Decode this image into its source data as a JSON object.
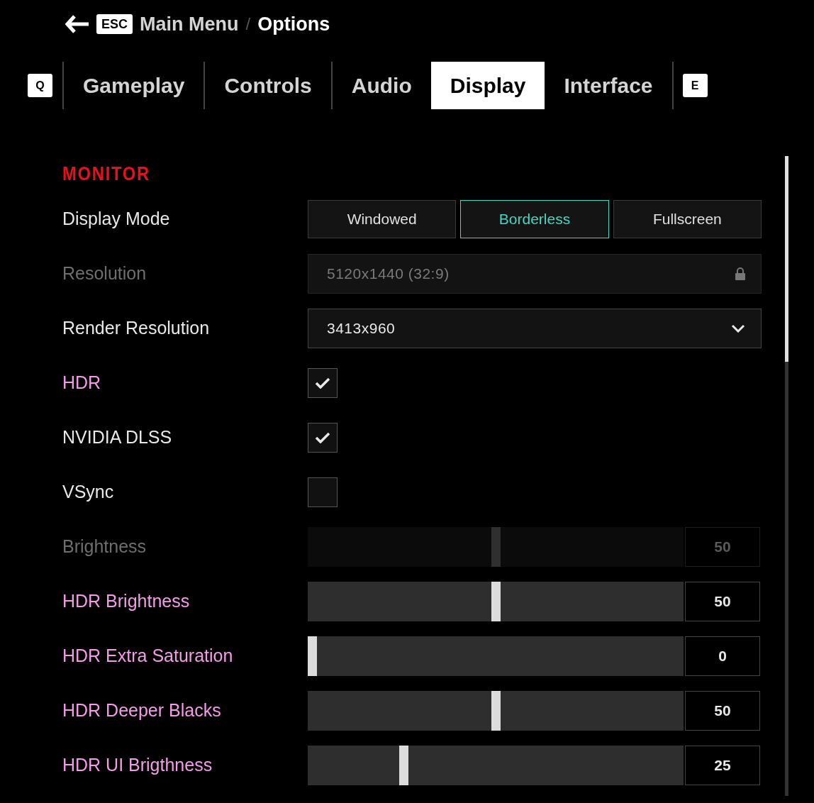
{
  "header": {
    "back_key": "ESC",
    "breadcrumb_parent": "Main Menu",
    "separator": "/",
    "breadcrumb_current": "Options"
  },
  "tabs": {
    "prev_key": "Q",
    "next_key": "E",
    "items": [
      {
        "label": "Gameplay",
        "selected": false
      },
      {
        "label": "Controls",
        "selected": false
      },
      {
        "label": "Audio",
        "selected": false
      },
      {
        "label": "Display",
        "selected": true
      },
      {
        "label": "Interface",
        "selected": false
      }
    ]
  },
  "section": {
    "title": "MONITOR"
  },
  "settings": [
    {
      "kind": "segmented",
      "label": "Display Mode",
      "disabled": false,
      "accent": false,
      "options": [
        {
          "label": "Windowed",
          "selected": false
        },
        {
          "label": "Borderless",
          "selected": true
        },
        {
          "label": "Fullscreen",
          "selected": false
        }
      ]
    },
    {
      "kind": "locked",
      "label": "Resolution",
      "disabled": true,
      "value": "5120x1440 (32:9)"
    },
    {
      "kind": "dropdown",
      "label": "Render Resolution",
      "disabled": false,
      "accent": false,
      "value": "3413x960"
    },
    {
      "kind": "checkbox",
      "label": "HDR",
      "disabled": false,
      "accent": true,
      "checked": true
    },
    {
      "kind": "checkbox",
      "label": "NVIDIA DLSS",
      "disabled": false,
      "accent": false,
      "checked": true
    },
    {
      "kind": "checkbox",
      "label": "VSync",
      "disabled": false,
      "accent": false,
      "checked": false
    },
    {
      "kind": "slider",
      "label": "Brightness",
      "disabled": true,
      "level": 0.5,
      "reading": "50"
    },
    {
      "kind": "slider",
      "label": "HDR Brightness",
      "disabled": false,
      "accent": true,
      "level": 0.5,
      "reading": "50"
    },
    {
      "kind": "slider",
      "label": "HDR Extra Saturation",
      "disabled": false,
      "accent": true,
      "level": 0,
      "reading": "0"
    },
    {
      "kind": "slider",
      "label": "HDR Deeper Blacks",
      "disabled": false,
      "accent": true,
      "level": 0.5,
      "reading": "50"
    },
    {
      "kind": "slider",
      "label": "HDR UI Brigthness",
      "disabled": false,
      "accent": true,
      "level": 0.25,
      "reading": "25"
    }
  ]
}
